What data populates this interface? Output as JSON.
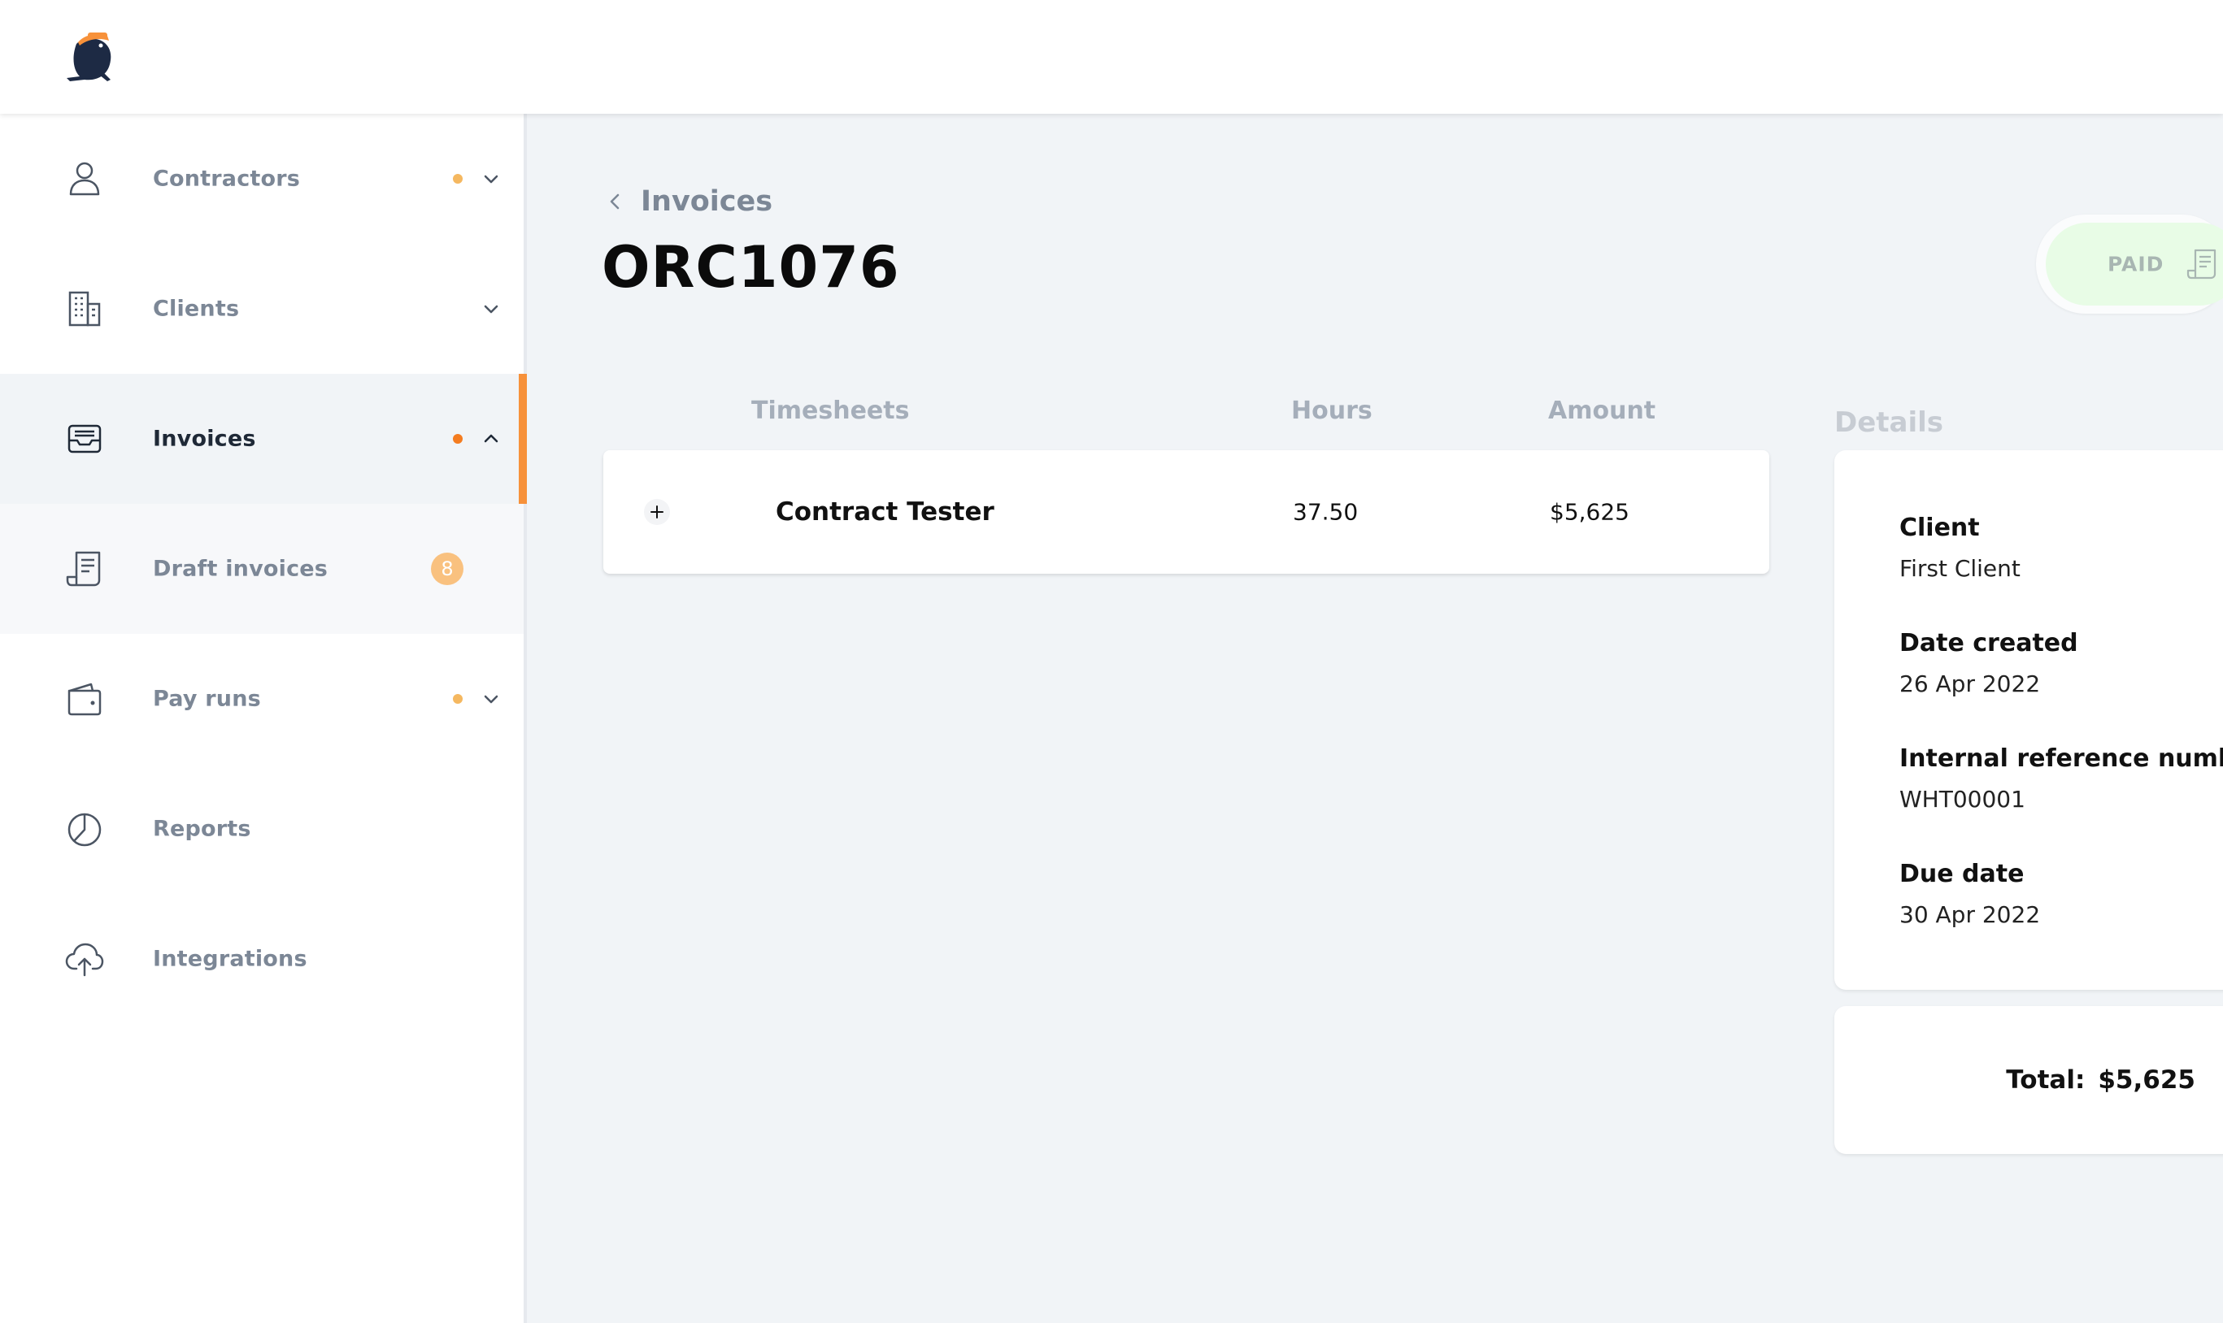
{
  "app": {
    "logo_icon": "mascot-logo-icon"
  },
  "colors": {
    "accent": "#f7913a",
    "dot_light": "#f5b860",
    "dot_strong": "#f47c20",
    "badge": "#f9c17f",
    "status_green": "#e8fce6"
  },
  "sidebar": {
    "items": [
      {
        "label": "Contractors",
        "icon": "person-icon"
      },
      {
        "label": "Clients",
        "icon": "building-icon"
      },
      {
        "label": "Invoices",
        "icon": "inbox-tray-icon"
      },
      {
        "label": "Draft invoices",
        "icon": "receipt-icon",
        "badge": "8"
      },
      {
        "label": "Pay runs",
        "icon": "wallet-icon"
      },
      {
        "label": "Reports",
        "icon": "pie-chart-icon"
      },
      {
        "label": "Integrations",
        "icon": "cloud-upload-icon"
      }
    ]
  },
  "header": {
    "back_label": "Invoices",
    "title": "ORC1076"
  },
  "status": {
    "label": "PAID",
    "icon": "receipt-icon"
  },
  "table": {
    "columns": [
      "Timesheets",
      "Hours",
      "Amount"
    ],
    "rows": [
      {
        "name": "Contract Tester",
        "hours": "37.50",
        "amount": "$5,625"
      }
    ]
  },
  "details": {
    "title": "Details",
    "fields": [
      {
        "label": "Client",
        "value": "First Client"
      },
      {
        "label": "Date created",
        "value": "26 Apr 2022"
      },
      {
        "label": "Internal reference numbe",
        "value": "WHT00001"
      },
      {
        "label": "Due date",
        "value": "30 Apr 2022"
      }
    ]
  },
  "total": {
    "label": "Total:",
    "value": "$5,625"
  }
}
